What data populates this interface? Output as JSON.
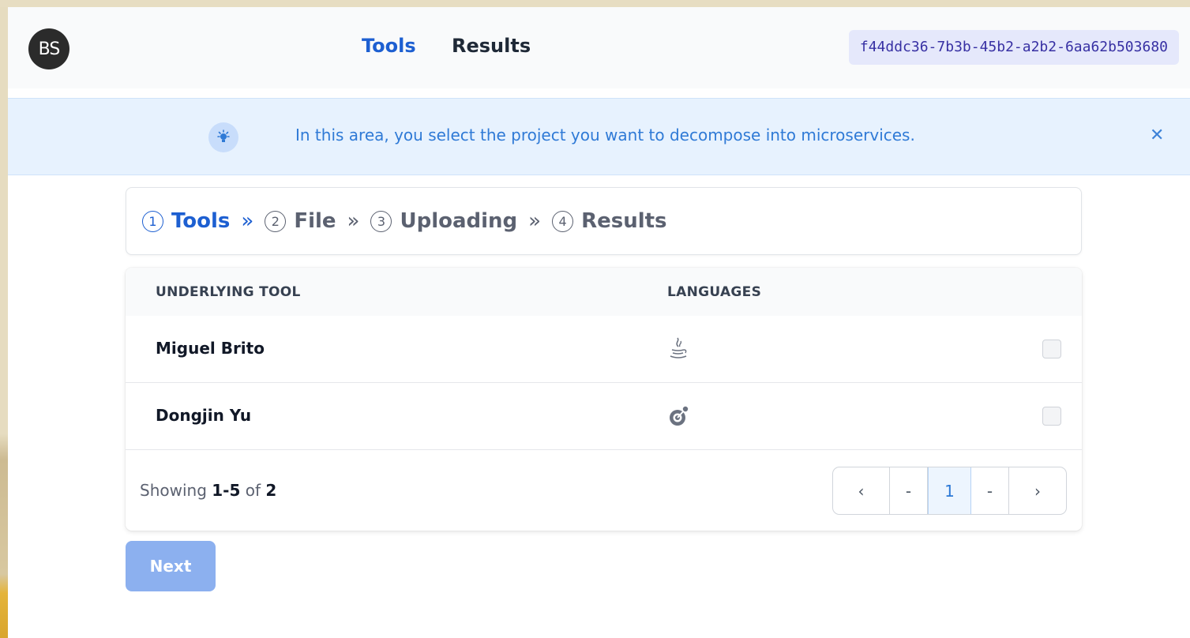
{
  "header": {
    "logo_text": "BS",
    "nav": [
      {
        "label": "Tools",
        "active": true
      },
      {
        "label": "Results",
        "active": false
      }
    ],
    "session_id": "f44ddc36-7b3b-45b2-a2b2-6aa62b503680"
  },
  "alert": {
    "icon": "lightbulb-icon",
    "text": "In this area, you select the project you want to decompose into microservices.",
    "close_label": "✕"
  },
  "steps": [
    {
      "num": "1",
      "label": "Tools",
      "active": true
    },
    {
      "num": "2",
      "label": "File",
      "active": false
    },
    {
      "num": "3",
      "label": "Uploading",
      "active": false
    },
    {
      "num": "4",
      "label": "Results",
      "active": false
    }
  ],
  "step_separator": "»",
  "table": {
    "columns": [
      "UNDERLYING TOOL",
      "LANGUAGES"
    ],
    "rows": [
      {
        "tool": "Miguel Brito",
        "language_icon": "java-icon",
        "checked": false
      },
      {
        "tool": "Dongjin Yu",
        "language_icon": "scala-icon",
        "checked": false
      }
    ]
  },
  "pagination": {
    "showing_prefix": "Showing",
    "range": "1-5",
    "of_word": "of",
    "total": "2",
    "prev": "‹",
    "dash_left": "-",
    "current": "1",
    "dash_right": "-",
    "next": "›"
  },
  "next_button": {
    "label": "Next",
    "disabled": true
  },
  "colors": {
    "accent": "#1d5fd1",
    "alert_bg": "#e7f2fe",
    "next_disabled": "#8cb0ef"
  }
}
